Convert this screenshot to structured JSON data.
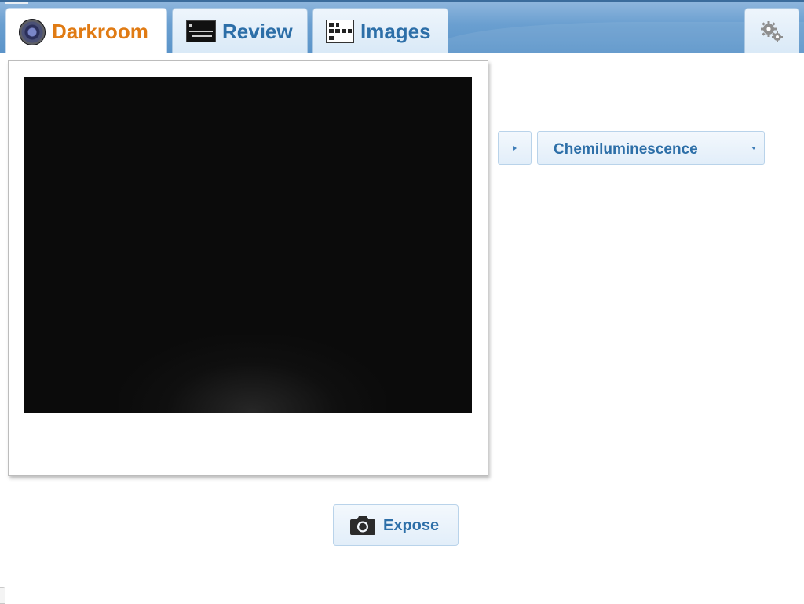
{
  "tabs": [
    {
      "label": "Darkroom",
      "icon": "camera-lens-icon",
      "active": true
    },
    {
      "label": "Review",
      "icon": "review-thumbnail-icon",
      "active": false
    },
    {
      "label": "Images",
      "icon": "images-thumbnail-icon",
      "active": false
    }
  ],
  "settings": {
    "icon": "gears-icon"
  },
  "preview": {
    "icon": "preview-image"
  },
  "mode": {
    "toggle_icon": "triangle-right-icon",
    "selected": "Chemiluminescence",
    "caret_icon": "chevron-down-icon"
  },
  "expose": {
    "label": "Expose",
    "icon": "camera-icon"
  },
  "colors": {
    "accent_active": "#e07b14",
    "accent_text": "#2d6fa8",
    "topbar": "#6a9fd0",
    "button_bg": "#e2eef9",
    "preview_bg": "#0b0b0b"
  }
}
